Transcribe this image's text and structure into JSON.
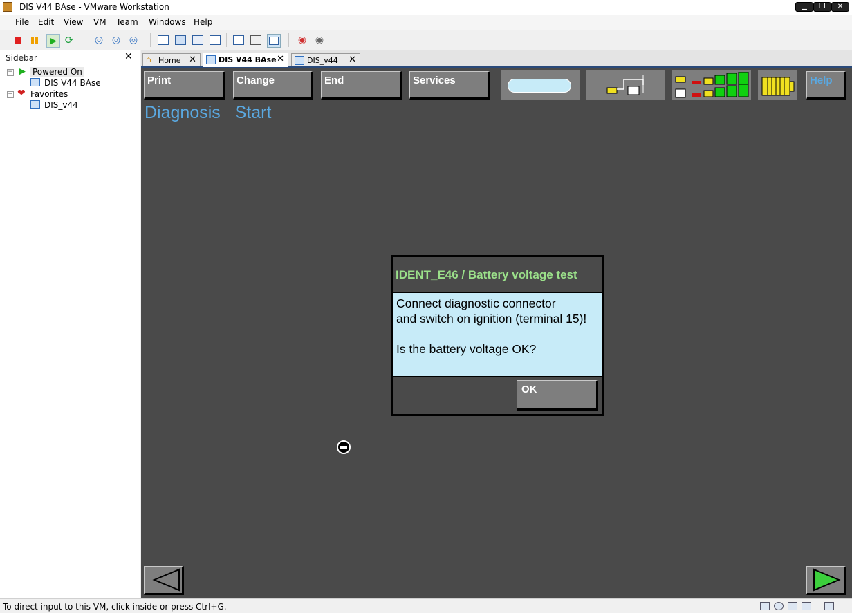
{
  "window": {
    "title": "DIS V44 BAse - VMware Workstation",
    "controls": [
      "minimize-icon",
      "restore-icon",
      "close-icon"
    ]
  },
  "menubar": {
    "items": [
      {
        "label": "File"
      },
      {
        "label": "Edit"
      },
      {
        "label": "View"
      },
      {
        "label": "VM"
      },
      {
        "label": "Team"
      },
      {
        "label": "Windows"
      },
      {
        "label": "Help"
      }
    ]
  },
  "toolbar": {
    "icons": [
      "power-off-icon",
      "suspend-icon",
      "power-on-icon",
      "reset-icon",
      "snapshot-icon",
      "revert-snapshot-icon",
      "snapshot-manager-icon",
      "view-console-icon",
      "full-screen-icon",
      "quick-switch-icon",
      "unity-icon",
      "view-summary-icon",
      "view-appliance-icon",
      "console-view-icon",
      "team-power-icon",
      "team-settings-icon"
    ]
  },
  "sidebar": {
    "title": "Sidebar",
    "close": "✕",
    "groups": [
      {
        "label": "Powered On",
        "items": [
          {
            "label": "DIS V44 BAse"
          }
        ]
      },
      {
        "label": "Favorites",
        "items": [
          {
            "label": "DIS_v44"
          }
        ]
      }
    ]
  },
  "tabs": [
    {
      "label": "Home",
      "active": false
    },
    {
      "label": "DIS V44 BAse",
      "active": true
    },
    {
      "label": "DIS_v44",
      "active": false
    }
  ],
  "dis": {
    "buttons": {
      "print": "Print",
      "change": "Change",
      "end": "End",
      "services": "Services",
      "help": "Help"
    },
    "heading": "Diagnosis   Start",
    "dialog": {
      "title": "IDENT_E46 / Battery voltage test",
      "lines": [
        "Connect diagnostic connector",
        "and switch on ignition (terminal 15)!",
        "",
        "Is the battery voltage OK?"
      ],
      "ok": "OK"
    }
  },
  "statusbar": {
    "text": "To direct input to this VM, click inside or press Ctrl+G."
  },
  "colors": {
    "vm_background": "#4a4a4a",
    "dis_button": "#7e7e7e",
    "heading": "#5aa8e0",
    "dialog_title": "#9be08a",
    "dialog_body": "#c7ebf8"
  }
}
